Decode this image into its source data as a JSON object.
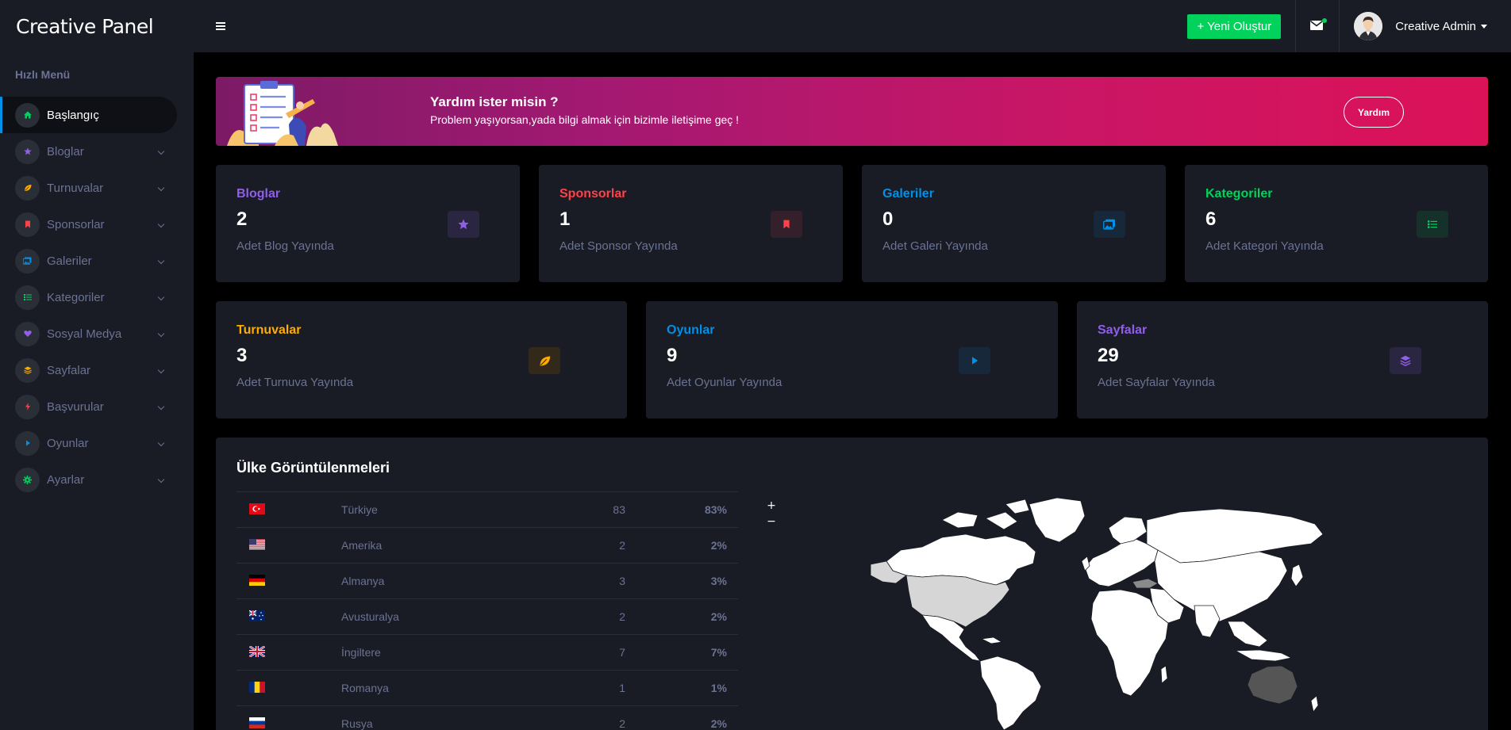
{
  "topbar": {
    "brand": "Creative Panel",
    "new_button": "+ Yeni Oluştur",
    "user_name": "Creative Admin"
  },
  "sidebar": {
    "title": "Hızlı Menü",
    "items": [
      {
        "label": "Başlangıç",
        "icon": "home-icon",
        "color": "#00d25b"
      },
      {
        "label": "Bloglar",
        "icon": "star-icon",
        "color": "#8f5fe8"
      },
      {
        "label": "Turnuvalar",
        "icon": "leaf-icon",
        "color": "#ffab00"
      },
      {
        "label": "Sponsorlar",
        "icon": "bookmark-icon",
        "color": "#fc424a"
      },
      {
        "label": "Galeriler",
        "icon": "images-icon",
        "color": "#0090e7"
      },
      {
        "label": "Kategoriler",
        "icon": "list-icon",
        "color": "#00d25b"
      },
      {
        "label": "Sosyal Medya",
        "icon": "heart-icon",
        "color": "#8f5fe8"
      },
      {
        "label": "Sayfalar",
        "icon": "layers-icon",
        "color": "#ffab00"
      },
      {
        "label": "Başvurular",
        "icon": "bolt-icon",
        "color": "#fc424a"
      },
      {
        "label": "Oyunlar",
        "icon": "play-icon",
        "color": "#0090e7"
      },
      {
        "label": "Ayarlar",
        "icon": "gear-icon",
        "color": "#00d25b"
      }
    ]
  },
  "banner": {
    "title": "Yardım ister misin ?",
    "subtitle": "Problem yaşıyorsan,yada bilgi almak için bizimle iletişime geç !",
    "button": "Yardım"
  },
  "stats_row1": [
    {
      "title": "Bloglar",
      "value": "2",
      "sub": "Adet Blog Yayında",
      "color": "#8f5fe8",
      "icon": "star-icon"
    },
    {
      "title": "Sponsorlar",
      "value": "1",
      "sub": "Adet Sponsor Yayında",
      "color": "#fc424a",
      "icon": "bookmark-icon"
    },
    {
      "title": "Galeriler",
      "value": "0",
      "sub": "Adet Galeri Yayında",
      "color": "#0090e7",
      "icon": "images-icon"
    },
    {
      "title": "Kategoriler",
      "value": "6",
      "sub": "Adet Kategori Yayında",
      "color": "#00d25b",
      "icon": "list-icon"
    }
  ],
  "stats_row2": [
    {
      "title": "Turnuvalar",
      "value": "3",
      "sub": "Adet Turnuva Yayında",
      "color": "#ffab00",
      "icon": "leaf-icon"
    },
    {
      "title": "Oyunlar",
      "value": "9",
      "sub": "Adet Oyunlar Yayında",
      "color": "#0090e7",
      "icon": "play-icon"
    },
    {
      "title": "Sayfalar",
      "value": "29",
      "sub": "Adet Sayfalar Yayında",
      "color": "#8f5fe8",
      "icon": "layers-icon"
    }
  ],
  "countries": {
    "title": "Ülke Görüntülenmeleri",
    "rows": [
      {
        "flag": "tr",
        "name": "Türkiye",
        "count": "83",
        "percent": "83%"
      },
      {
        "flag": "us",
        "name": "Amerika",
        "count": "2",
        "percent": "2%"
      },
      {
        "flag": "de",
        "name": "Almanya",
        "count": "3",
        "percent": "3%"
      },
      {
        "flag": "au",
        "name": "Avusturalya",
        "count": "2",
        "percent": "2%"
      },
      {
        "flag": "gb",
        "name": "İngiltere",
        "count": "7",
        "percent": "7%"
      },
      {
        "flag": "ro",
        "name": "Romanya",
        "count": "1",
        "percent": "1%"
      },
      {
        "flag": "ru",
        "name": "Rusya",
        "count": "2",
        "percent": "2%"
      }
    ],
    "zoom_in": "+",
    "zoom_out": "−"
  }
}
